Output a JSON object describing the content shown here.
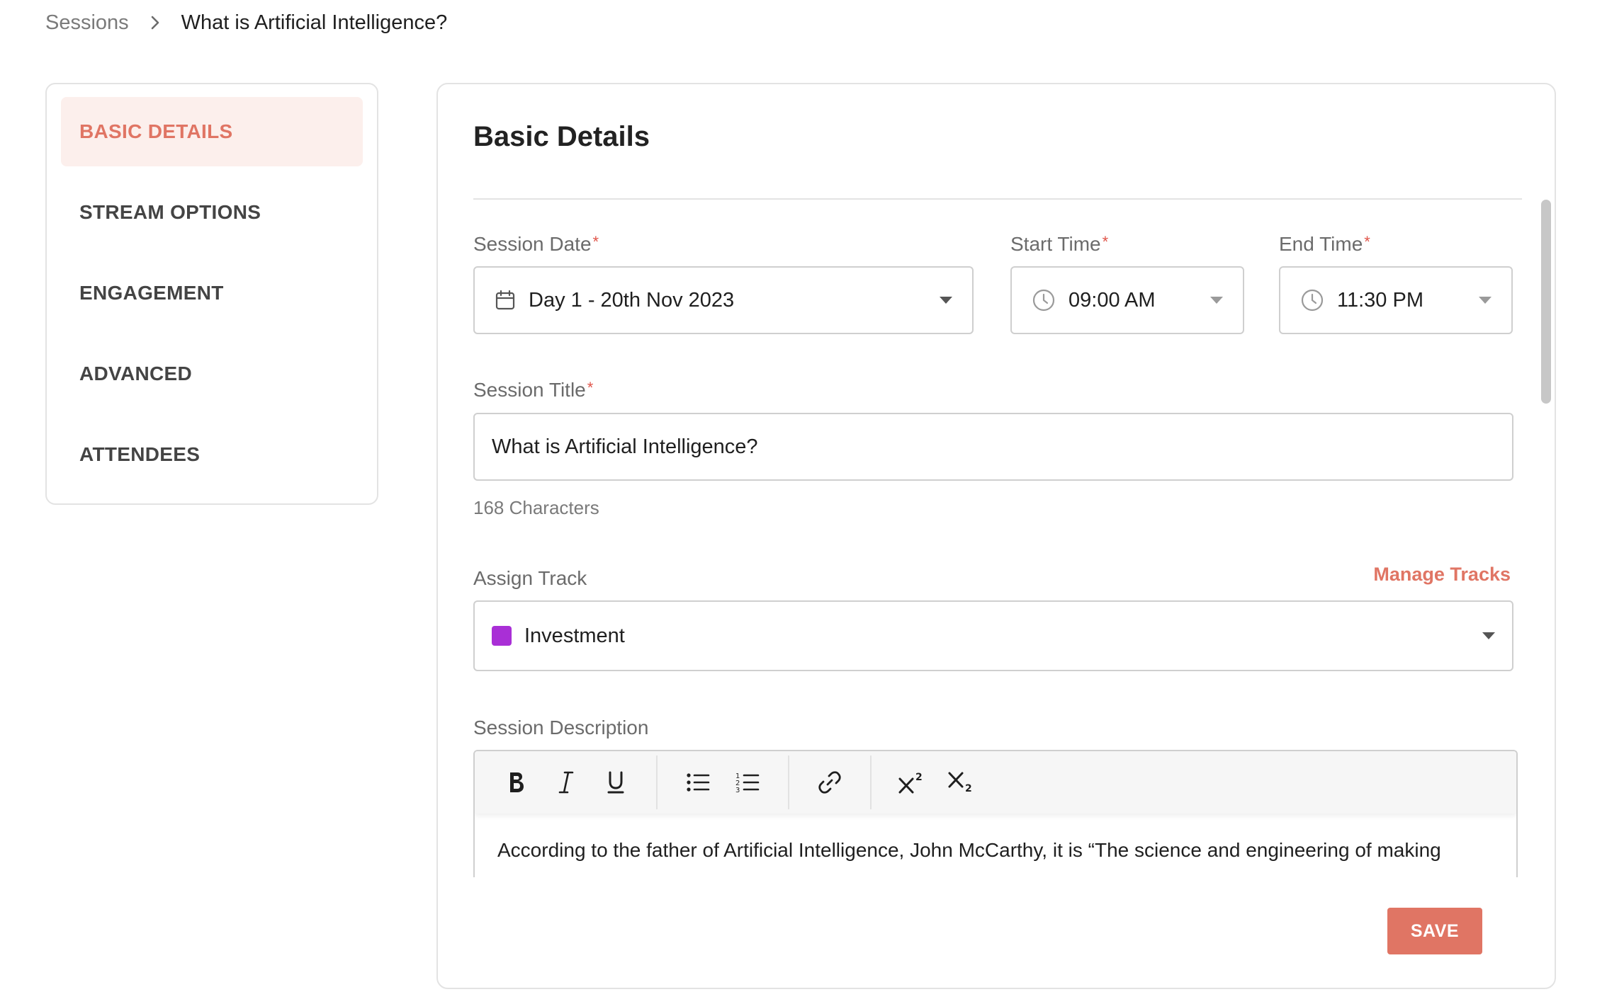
{
  "breadcrumb": {
    "root": "Sessions",
    "current": "What is Artificial Intelligence?"
  },
  "sidebar": {
    "items": [
      {
        "label": "BASIC DETAILS",
        "active": true
      },
      {
        "label": "STREAM OPTIONS",
        "active": false
      },
      {
        "label": "ENGAGEMENT",
        "active": false
      },
      {
        "label": "ADVANCED",
        "active": false
      },
      {
        "label": "ATTENDEES",
        "active": false
      }
    ]
  },
  "form": {
    "title": "Basic Details",
    "session_date": {
      "label": "Session Date",
      "required_mark": "*",
      "value": "Day 1 - 20th Nov 2023",
      "icon": "calendar-icon"
    },
    "start_time": {
      "label": "Start Time",
      "required_mark": "*",
      "value": "09:00 AM",
      "icon": "clock-icon"
    },
    "end_time": {
      "label": "End Time",
      "required_mark": "*",
      "value": "11:30 PM",
      "icon": "clock-icon"
    },
    "session_title": {
      "label": "Session Title",
      "required_mark": "*",
      "value": "What is Artificial Intelligence?",
      "char_count": "168 Characters"
    },
    "assign_track": {
      "label": "Assign Track",
      "manage_link": "Manage Tracks",
      "value": "Investment",
      "swatch_color": "#a92fd6"
    },
    "description": {
      "label": "Session Description",
      "toolbar": [
        "bold-icon",
        "italic-icon",
        "underline-icon",
        "bullet-list-icon",
        "numbered-list-icon",
        "link-icon",
        "superscript-icon",
        "subscript-icon"
      ],
      "text": "According to the father of Artificial Intelligence, John McCarthy, it is “The science and engineering of making"
    },
    "save_label": "SAVE"
  },
  "colors": {
    "accent": "#e07564",
    "accent_bg": "#fcefec",
    "required": "#e0554a"
  }
}
